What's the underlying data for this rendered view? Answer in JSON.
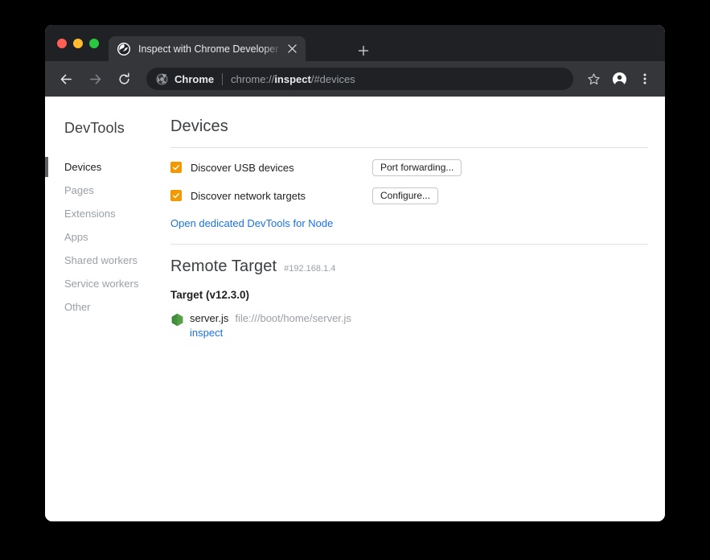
{
  "browser": {
    "window_controls": [
      "close",
      "minimize",
      "maximize"
    ],
    "tab": {
      "title": "Inspect with Chrome Developer",
      "favicon_name": "devtools-favicon",
      "close_label": "×"
    },
    "new_tab_label": "+",
    "toolbar": {
      "back_label": "←",
      "forward_label": "→",
      "reload_label": "↻",
      "omnibox_chip": "Chrome",
      "url_prefix": "chrome://",
      "url_bold": "inspect",
      "url_suffix": "/#devices",
      "bookmark_label": "☆",
      "profile_label": "profile",
      "menu_label": "⋮"
    }
  },
  "sidebar": {
    "title": "DevTools",
    "items": [
      {
        "label": "Devices",
        "active": true
      },
      {
        "label": "Pages",
        "active": false
      },
      {
        "label": "Extensions",
        "active": false
      },
      {
        "label": "Apps",
        "active": false
      },
      {
        "label": "Shared workers",
        "active": false
      },
      {
        "label": "Service workers",
        "active": false
      },
      {
        "label": "Other",
        "active": false
      }
    ]
  },
  "main": {
    "heading": "Devices",
    "options": [
      {
        "label": "Discover USB devices",
        "checked": true,
        "button": "Port forwarding..."
      },
      {
        "label": "Discover network targets",
        "checked": true,
        "button": "Configure..."
      }
    ],
    "node_link": "Open dedicated DevTools for Node",
    "remote_target": {
      "heading": "Remote Target",
      "address": "#192.168.1.4",
      "target_title": "Target (v12.3.0)",
      "entries": [
        {
          "icon_name": "nodejs-icon",
          "name": "server.js",
          "url": "file:///boot/home/server.js",
          "action": "inspect"
        }
      ]
    }
  },
  "colors": {
    "accent_blue": "#1a73e8",
    "checkbox_orange": "#f29900",
    "chrome_dark": "#202124",
    "toolbar_dark": "#35363a",
    "node_green": "#43853d"
  }
}
